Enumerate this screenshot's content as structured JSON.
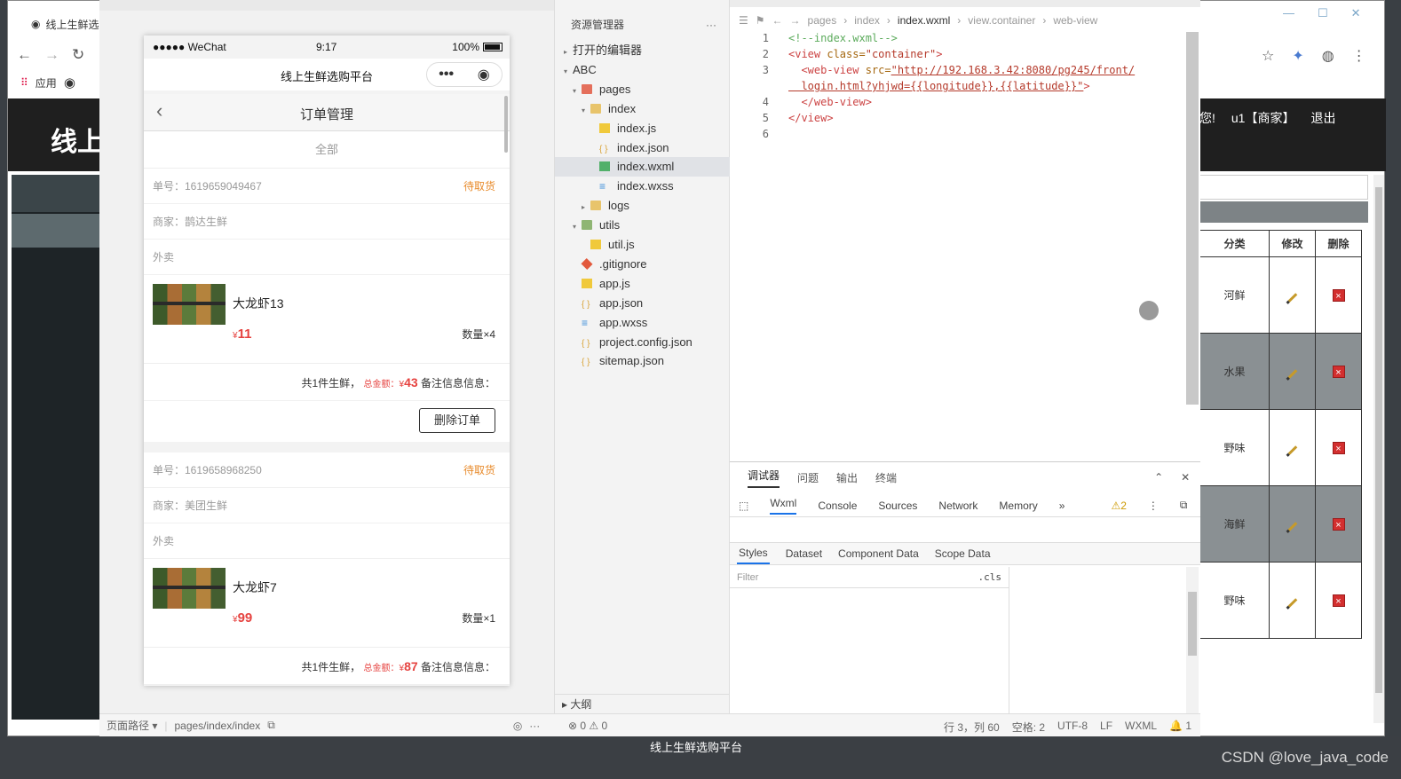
{
  "browser": {
    "tab_title": "线上生鲜选",
    "bookmark_apps": "应用",
    "header_logo": "线上",
    "header_nav": [
      "您!",
      "u1【商家】",
      "退出"
    ],
    "table": {
      "headers": [
        "分类",
        "修改",
        "删除"
      ],
      "rows": [
        {
          "category": "河鲜"
        },
        {
          "category": "水果"
        },
        {
          "category": "野味"
        },
        {
          "category": "海鲜"
        },
        {
          "category": "野味"
        }
      ]
    }
  },
  "simulator": {
    "status_carrier": "●●●●● WeChat",
    "status_time": "9:17",
    "status_battery": "100%",
    "nav_title": "线上生鲜选购平台",
    "page_title": "订单管理",
    "filter_label": "全部",
    "orders": [
      {
        "order_no": "单号：1619659049467",
        "status": "待取货",
        "merchant": "商家：鹊达生鲜",
        "delivery": "外卖",
        "product_name": "大龙虾13",
        "product_price": "11",
        "currency": "¥",
        "quantity": "数量×4",
        "summary_count": "共1件生鲜，",
        "summary_total_label": "总金额：¥",
        "summary_total": "43",
        "summary_note": "备注信息信息：",
        "delete_label": "删除订单"
      },
      {
        "order_no": "单号：1619658968250",
        "status": "待取货",
        "merchant": "商家：美团生鲜",
        "delivery": "外卖",
        "product_name": "大龙虾7",
        "product_price": "99",
        "currency": "¥",
        "quantity": "数量×1",
        "summary_count": "共1件生鲜，",
        "summary_total_label": "总金额：¥",
        "summary_total": "87",
        "summary_note": "备注信息信息："
      }
    ],
    "footer_path_label": "页面路径 ▾",
    "footer_path": "pages/index/index"
  },
  "explorer": {
    "title": "资源管理器",
    "more": "···",
    "items": [
      {
        "label": "打开的编辑器",
        "arrow": "▸",
        "icon": "none"
      },
      {
        "label": "ABC",
        "arrow": "▾",
        "icon": "none"
      },
      {
        "label": "pages",
        "arrow": "▾",
        "icon": "folder-red"
      },
      {
        "label": "index",
        "arrow": "▾",
        "icon": "folder"
      },
      {
        "label": "index.js",
        "arrow": "",
        "icon": "js"
      },
      {
        "label": "index.json",
        "arrow": "",
        "icon": "json"
      },
      {
        "label": "index.wxml",
        "arrow": "",
        "icon": "wxml"
      },
      {
        "label": "index.wxss",
        "arrow": "",
        "icon": "wxss"
      },
      {
        "label": "logs",
        "arrow": "▸",
        "icon": "folder"
      },
      {
        "label": "utils",
        "arrow": "▾",
        "icon": "folder-grn"
      },
      {
        "label": "util.js",
        "arrow": "",
        "icon": "js"
      },
      {
        "label": ".gitignore",
        "arrow": "",
        "icon": "git"
      },
      {
        "label": "app.js",
        "arrow": "",
        "icon": "js"
      },
      {
        "label": "app.json",
        "arrow": "",
        "icon": "json"
      },
      {
        "label": "app.wxss",
        "arrow": "",
        "icon": "wxss"
      },
      {
        "label": "project.config.json",
        "arrow": "",
        "icon": "json"
      },
      {
        "label": "sitemap.json",
        "arrow": "",
        "icon": "json"
      }
    ],
    "outline": "大纲"
  },
  "editor": {
    "breadcrumb": [
      "pages",
      "index",
      "index.wxml",
      "view.container",
      "web-view"
    ],
    "lines": [
      {
        "num": "1",
        "parts": [
          {
            "c": "tk-cm",
            "t": "<!--index.wxml-->"
          }
        ]
      },
      {
        "num": "2",
        "parts": [
          {
            "c": "tk-tag",
            "t": "<view "
          },
          {
            "c": "tk-attr",
            "t": "class="
          },
          {
            "c": "tk-str",
            "t": "\"container\""
          },
          {
            "c": "tk-tag",
            "t": ">"
          }
        ]
      },
      {
        "num": "3",
        "parts": [
          {
            "c": "tk-tag",
            "t": "  <web-view "
          },
          {
            "c": "tk-attr",
            "t": "src="
          },
          {
            "c": "tk-str2",
            "t": "\"http://192.168.3.42:8080/pg245/front/"
          }
        ]
      },
      {
        "num": "",
        "parts": [
          {
            "c": "tk-str2",
            "t": "  login.html?yhjwd={{longitude}},{{latitude}}\""
          },
          {
            "c": "tk-tag",
            "t": ">"
          }
        ]
      },
      {
        "num": "4",
        "parts": [
          {
            "c": "tk-tag",
            "t": "  </web-view>"
          }
        ]
      },
      {
        "num": "5",
        "parts": [
          {
            "c": "tk-tag",
            "t": "</view>"
          }
        ]
      },
      {
        "num": "6",
        "parts": []
      }
    ]
  },
  "devtools": {
    "tabs1": [
      "调试器",
      "问题",
      "输出",
      "终端"
    ],
    "tabs2": [
      "Wxml",
      "Console",
      "Sources",
      "Network",
      "Memory"
    ],
    "warning_count": "2",
    "tabs3": [
      "Styles",
      "Dataset",
      "Component Data",
      "Scope Data"
    ],
    "filter_placeholder": "Filter",
    "cls_label": ".cls"
  },
  "status_bar": {
    "errors": "⊗ 0 ⚠ 0",
    "items": [
      "行 3，列 60",
      "空格: 2",
      "UTF-8",
      "LF",
      "WXML",
      "🔔 1"
    ]
  },
  "taskbar": {
    "title": "线上生鲜选购平台",
    "watermark": "CSDN @love_java_code"
  }
}
